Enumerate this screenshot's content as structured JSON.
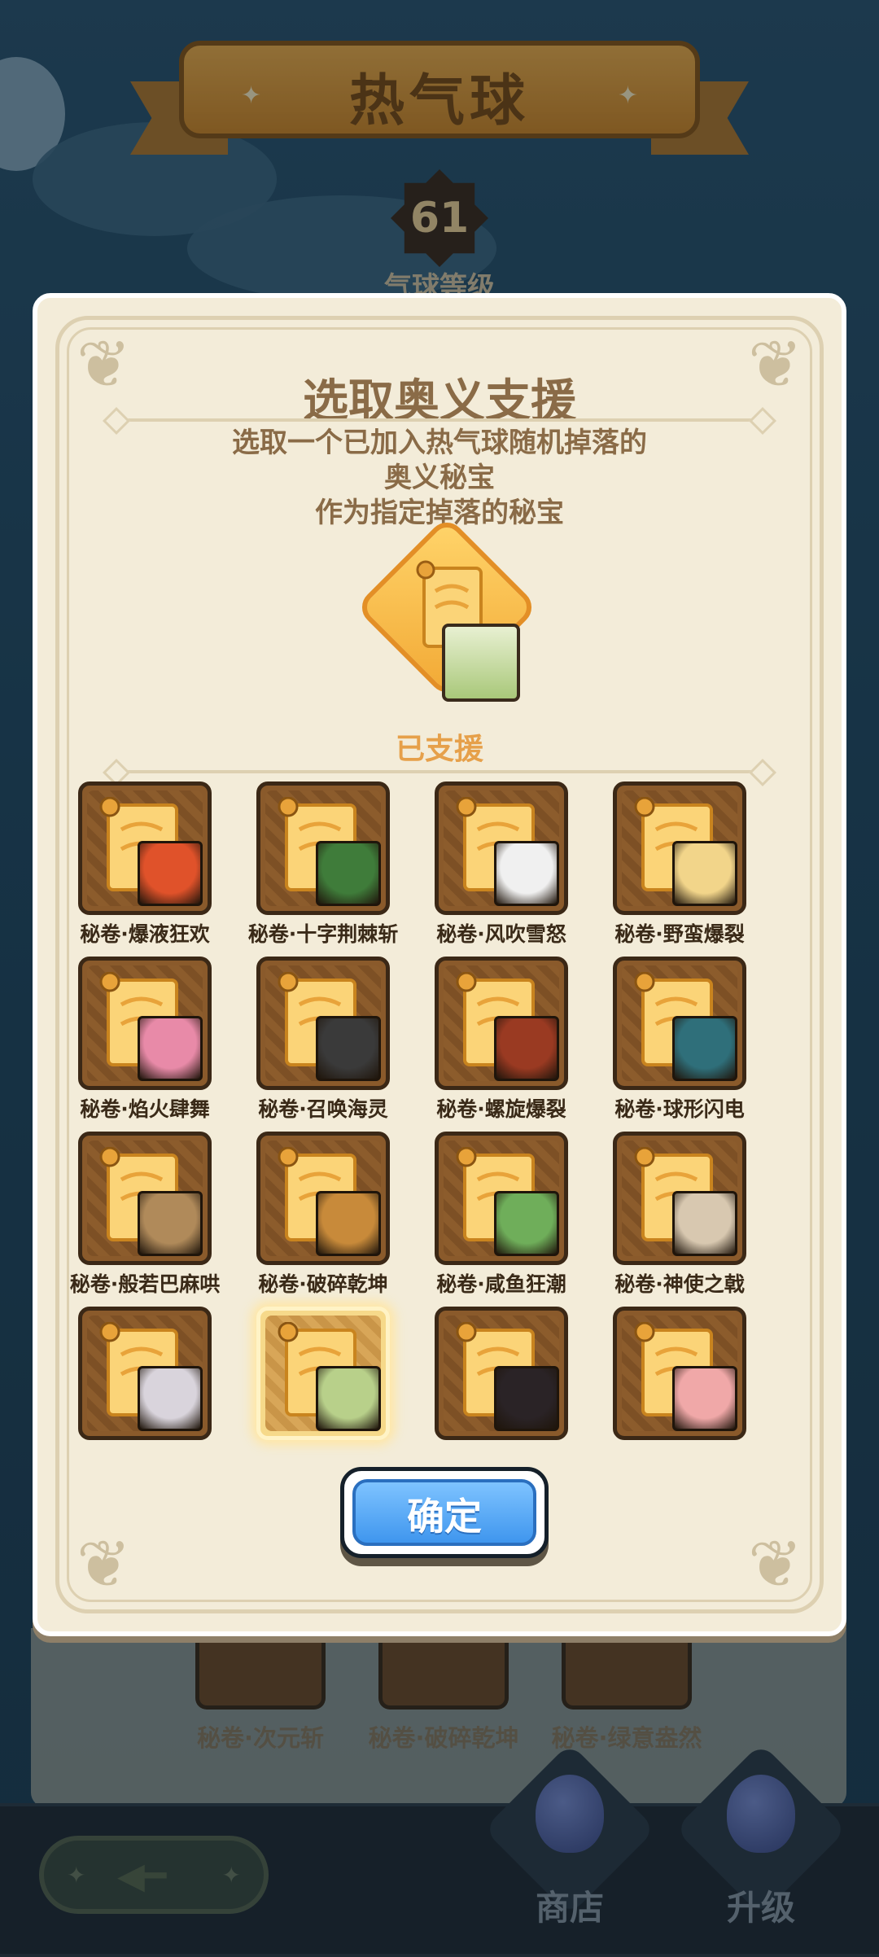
{
  "header": {
    "title": "热气球",
    "level": "61",
    "level_caption": "气球等级"
  },
  "dialog": {
    "title": "选取奥义支援",
    "description_lines": [
      "选取一个已加入热气球随机掉落的",
      "奥义秘宝",
      "作为指定掉落的秘宝"
    ],
    "supported_label": "已支援",
    "confirm_label": "确定",
    "items": [
      {
        "label": "秘卷·爆液狂欢",
        "face_color": "#e0522a",
        "selected": false
      },
      {
        "label": "秘卷·十字荆棘斩",
        "face_color": "#3f7c3a",
        "selected": false
      },
      {
        "label": "秘卷·风吹雪怒",
        "face_color": "#f0f0f0",
        "selected": false
      },
      {
        "label": "秘卷·野蛮爆裂",
        "face_color": "#f2d58a",
        "selected": false
      },
      {
        "label": "秘卷·焰火肆舞",
        "face_color": "#e88aa8",
        "selected": false
      },
      {
        "label": "秘卷·召唤海灵",
        "face_color": "#3a3a3a",
        "selected": false
      },
      {
        "label": "秘卷·螺旋爆裂",
        "face_color": "#9a3a22",
        "selected": false
      },
      {
        "label": "秘卷·球形闪电",
        "face_color": "#2f6f7a",
        "selected": false
      },
      {
        "label": "秘卷·般若巴麻哄",
        "face_color": "#b08a5a",
        "selected": false
      },
      {
        "label": "秘卷·破碎乾坤",
        "face_color": "#c88a3a",
        "selected": false
      },
      {
        "label": "秘卷·咸鱼狂潮",
        "face_color": "#6fae5a",
        "selected": false
      },
      {
        "label": "秘卷·神使之戟",
        "face_color": "#d8c8b0",
        "selected": false
      },
      {
        "label": "",
        "face_color": "#d9d4dc",
        "selected": false
      },
      {
        "label": "",
        "face_color": "#b8d08a",
        "selected": true
      },
      {
        "label": "",
        "face_color": "#2a2326",
        "selected": false
      },
      {
        "label": "",
        "face_color": "#f0a8a8",
        "selected": false
      }
    ]
  },
  "bottom_list": [
    "秘卷·次元斩",
    "秘卷·破碎乾坤",
    "秘卷·绿意盎然"
  ],
  "nav": {
    "shop_label": "商店",
    "upgrade_label": "升级"
  },
  "colors": {
    "accent_blue": "#3f96ee",
    "scroll_gold": "#f2b43a",
    "tile_brown": "#8a5a2b"
  }
}
